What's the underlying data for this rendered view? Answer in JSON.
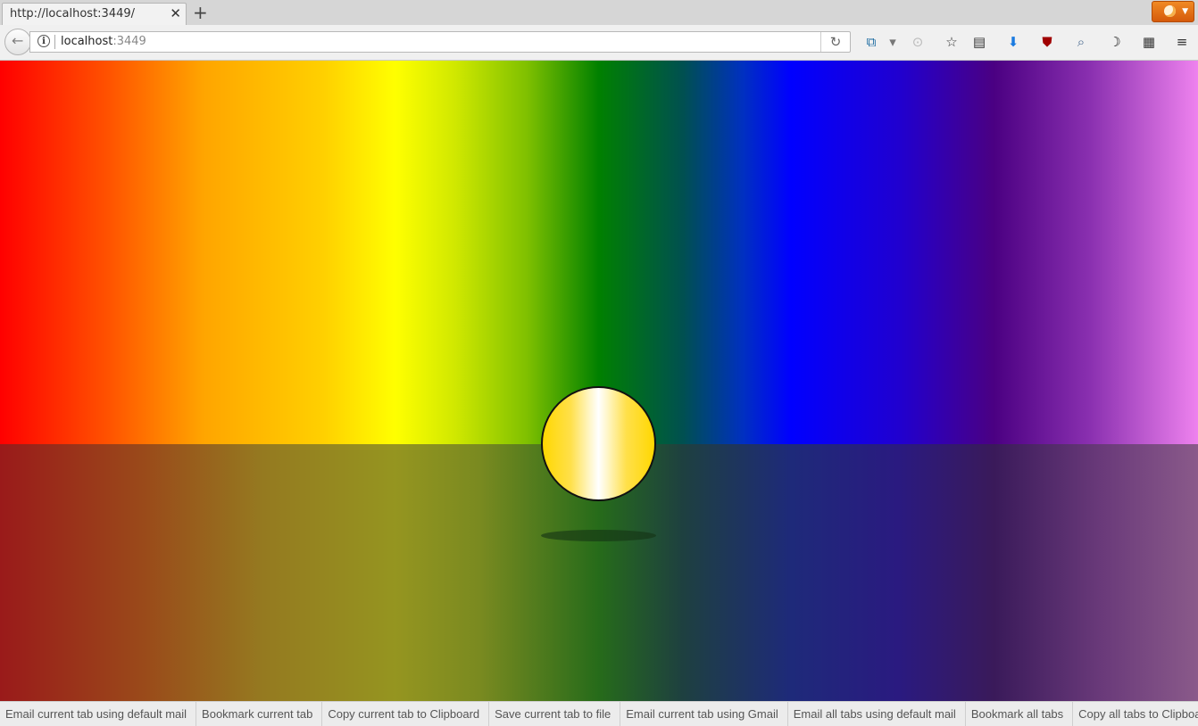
{
  "tab": {
    "title": "http://localhost:3449/",
    "close": "✕",
    "new_tab": "+"
  },
  "nav": {
    "back": "←",
    "info": "i",
    "url_host": "localhost",
    "url_port": ":3449",
    "reload": "↻"
  },
  "toolbar_icons": [
    {
      "name": "screenshot-extension-icon",
      "glyph": "⧉"
    },
    {
      "name": "dropdown-arrow-icon",
      "glyph": "▾"
    },
    {
      "name": "rss-feed-icon",
      "glyph": "⊙"
    },
    {
      "name": "bookmark-star-icon",
      "glyph": "☆"
    },
    {
      "name": "reading-list-icon",
      "glyph": "▤"
    },
    {
      "name": "download-icon",
      "glyph": "⬇"
    },
    {
      "name": "ublock-shield-icon",
      "glyph": "⛊"
    },
    {
      "name": "search-extension-icon",
      "glyph": "⌕"
    },
    {
      "name": "night-mode-moon-icon",
      "glyph": "☽"
    },
    {
      "name": "qr-code-icon",
      "glyph": "▦"
    },
    {
      "name": "hamburger-menu-icon",
      "glyph": "≡"
    }
  ],
  "bottom_bar": [
    "Email current tab using default mail",
    "Bookmark current tab",
    "Copy current tab to Clipboard",
    "Save current tab to file",
    "Email current tab using Gmail",
    "Email all tabs using default mail",
    "Bookmark all tabs",
    "Copy all tabs to Clipboard"
  ],
  "colors": {
    "ball": "#ffd700",
    "sky_start": "#ff0000",
    "sky_end": "#ee82ee"
  }
}
